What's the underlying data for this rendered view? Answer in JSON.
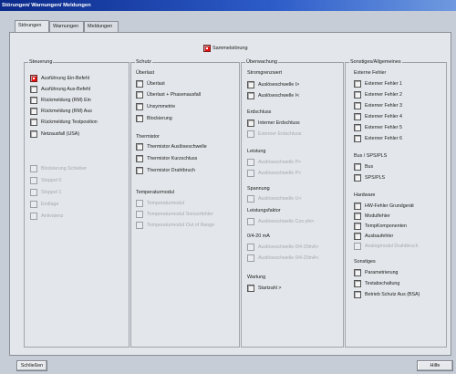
{
  "window_title": "Störungen/ Warnungen/ Meldungen",
  "tabs": [
    {
      "label": "Störungen"
    },
    {
      "label": "Warnungen"
    },
    {
      "label": "Meldungen"
    }
  ],
  "sammelstoerung": {
    "label": "Sammelstörung"
  },
  "groups": {
    "steuerung": "Steuerung",
    "schutz": "Schutz",
    "ueberwachung": "Überwachung",
    "sonstiges": "Sonstiges/Allgemeines"
  },
  "subheadings": {
    "ueberlast": "Überlast",
    "thermistor": "Thermistor",
    "temperaturmodul": "Temperaturmodul",
    "stromgrenzwert": "Stromgrenzwert",
    "erdschluss": "Erdschluss",
    "leistung": "Leistung",
    "spannung": "Spannung",
    "leistungsfaktor": "Leistungsfaktor",
    "ma": "0/4-20 mA",
    "wartung": "Wartung",
    "externe_fehler": "Externe Fehler",
    "bus": "Bus / SPS/PLS",
    "hardware": "Hardware",
    "sonstiges_sub": "Sonstiges"
  },
  "items": {
    "steuerung": [
      "Ausführung Ein-Befehl",
      "Ausführung Aus-Befehl",
      "Rückmeldung (RM) Ein",
      "Rückmeldung (RM) Aus",
      "Rückmeldung Testposition",
      "Netzausfall (USA)"
    ],
    "steuerung_disabled": [
      "Blockierung Schieber",
      "Stoppel 0",
      "Stoppel 1",
      "Endlage",
      "Antivalenz"
    ],
    "ueberlast": [
      "Überlast",
      "Überlast + Phasenausfall",
      "Unsymmetrie",
      "Blockierung"
    ],
    "thermistor": [
      "Thermistor Auslöseschwelle",
      "Thermistor Kurzschluss",
      "Thermistor Drahtbruch"
    ],
    "temperaturmodul": [
      "Temperaturmodul",
      "Temperaturmodul Sensorfehler",
      "Temperaturmodul Out of Range"
    ],
    "stromgrenzwert": [
      "Auslöseschwelle I>",
      "Auslöseschwelle I<"
    ],
    "erdschluss": [
      "Interner Erdschluss",
      "Externer Erdschluss"
    ],
    "leistung": [
      "Auslöseschwelle P>",
      "Auslöseschwelle P<"
    ],
    "spannung": [
      "Auslöseschwelle U<"
    ],
    "leistungsfaktor": [
      "Auslöseschwelle Cos phi<"
    ],
    "ma": [
      "Auslöseschwelle 0/4-20mA>",
      "Auslöseschwelle 0/4-20mA<"
    ],
    "wartung": [
      "Startzahl >"
    ],
    "externe_fehler": [
      "Externer Fehler 1",
      "Externer Fehler 2",
      "Externer Fehler 3",
      "Externer Fehler 4",
      "Externer Fehler 5",
      "Externer Fehler 6"
    ],
    "bus": [
      "Bus",
      "SPS/PLS"
    ],
    "hardware": [
      "HW-Fehler Grundgerät",
      "Modulfehler",
      "TempKomponenten",
      "Ausbaufehler",
      "Analogmodul Drahtbruch"
    ],
    "sonstiges_sub": [
      "Parametrierung",
      "Testabschaltung",
      "Betrieb Schutz Aus (BSA)"
    ]
  },
  "buttons": {
    "close": "Schließen",
    "help": "Hilfe"
  },
  "colors": {
    "titlebar_start": "#0b2a8a",
    "active_indicator": "#e11111",
    "background": "#6f8cc3"
  }
}
